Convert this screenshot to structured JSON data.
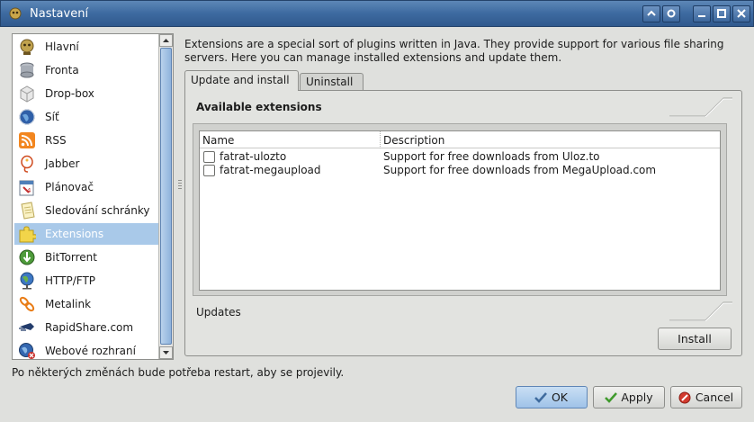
{
  "window": {
    "title": "Nastavení"
  },
  "sidebar": {
    "items": [
      {
        "label": "Hlavní",
        "icon": "hlavni-icon"
      },
      {
        "label": "Fronta",
        "icon": "queue-icon"
      },
      {
        "label": "Drop-box",
        "icon": "drop-box-icon"
      },
      {
        "label": "Síť",
        "icon": "network-globe-icon"
      },
      {
        "label": "RSS",
        "icon": "rss-icon"
      },
      {
        "label": "Jabber",
        "icon": "jabber-icon"
      },
      {
        "label": "Plánovač",
        "icon": "calendar-icon"
      },
      {
        "label": "Sledování schránky",
        "icon": "clipboard-icon"
      },
      {
        "label": "Extensions",
        "icon": "puzzle-icon"
      },
      {
        "label": "BitTorrent",
        "icon": "bittorrent-icon"
      },
      {
        "label": "HTTP/FTP",
        "icon": "http-ftp-icon"
      },
      {
        "label": "Metalink",
        "icon": "metalink-icon"
      },
      {
        "label": "RapidShare.com",
        "icon": "rapidshare-icon"
      },
      {
        "label": "Webové rozhraní",
        "icon": "web-interface-icon"
      }
    ],
    "selected": "Extensions"
  },
  "main": {
    "description": "Extensions are a special sort of plugins written in Java. They provide support for various file sharing servers. Here you can manage installed extensions and update them.",
    "tabs": [
      {
        "label": "Update and install",
        "active": true
      },
      {
        "label": "Uninstall",
        "active": false
      }
    ],
    "available_title": "Available extensions",
    "table": {
      "columns": [
        "Name",
        "Description"
      ],
      "rows": [
        {
          "name": "fatrat-ulozto",
          "description": "Support for free downloads from Uloz.to",
          "checked": false
        },
        {
          "name": "fatrat-megaupload",
          "description": "Support for free downloads from MegaUpload.com",
          "checked": false
        }
      ]
    },
    "updates_title": "Updates",
    "install_label": "Install"
  },
  "footer": {
    "note": "Po některých změnách bude potřeba restart, aby se projevily.",
    "ok_label": "OK",
    "apply_label": "Apply",
    "cancel_label": "Cancel"
  },
  "colors": {
    "titlebar": "#3d6aa0",
    "selection": "#a9c9e9",
    "ok_button": "#9fc2e8"
  }
}
